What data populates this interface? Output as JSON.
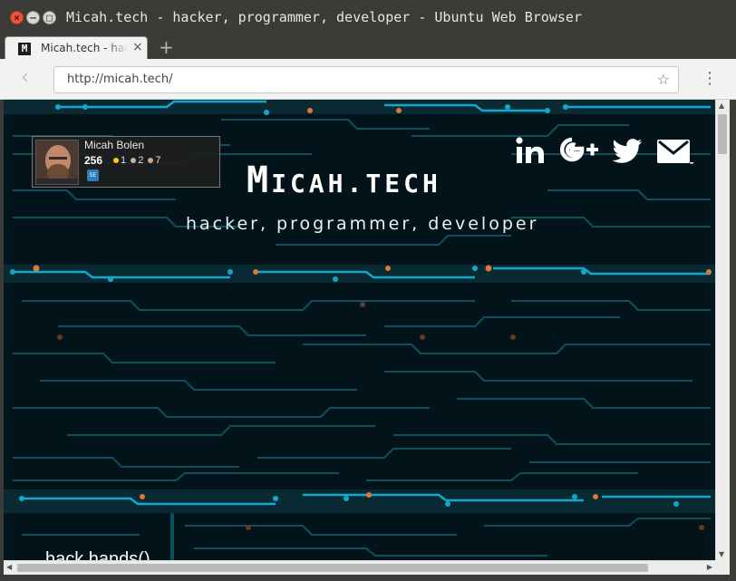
{
  "window": {
    "title": "Micah.tech - hacker, programmer, developer - Ubuntu Web Browser"
  },
  "tab": {
    "title": "Micah.tech - hacker, programmer, developer",
    "favicon_text": "M",
    "close_glyph": "×"
  },
  "new_tab_glyph": "+",
  "toolbar": {
    "back_glyph": "‹",
    "url": "http://micah.tech/",
    "bookmark_glyph": "☆",
    "menu_glyph": "⋮"
  },
  "page": {
    "flair": {
      "name": "Micah Bolen",
      "reputation": "256",
      "gold": "1",
      "silver": "2",
      "bronze": "7",
      "site_badge": "SE"
    },
    "logo": {
      "big1": "M",
      "rest1": "ICAH",
      "dot": ".",
      "rest2": "TECH"
    },
    "tagline": "hacker, programmer, developer",
    "social": [
      "linkedin-icon",
      "google-plus-icon",
      "twitter-icon",
      "email-icon"
    ],
    "section_heading": "hack hands()"
  },
  "colors": {
    "board_bg": "#03161c",
    "trace_bright": "#12a9cf",
    "trace_dim": "#0f4f60",
    "pad_orange": "#e0773a",
    "title_bar": "#3c3b37"
  }
}
